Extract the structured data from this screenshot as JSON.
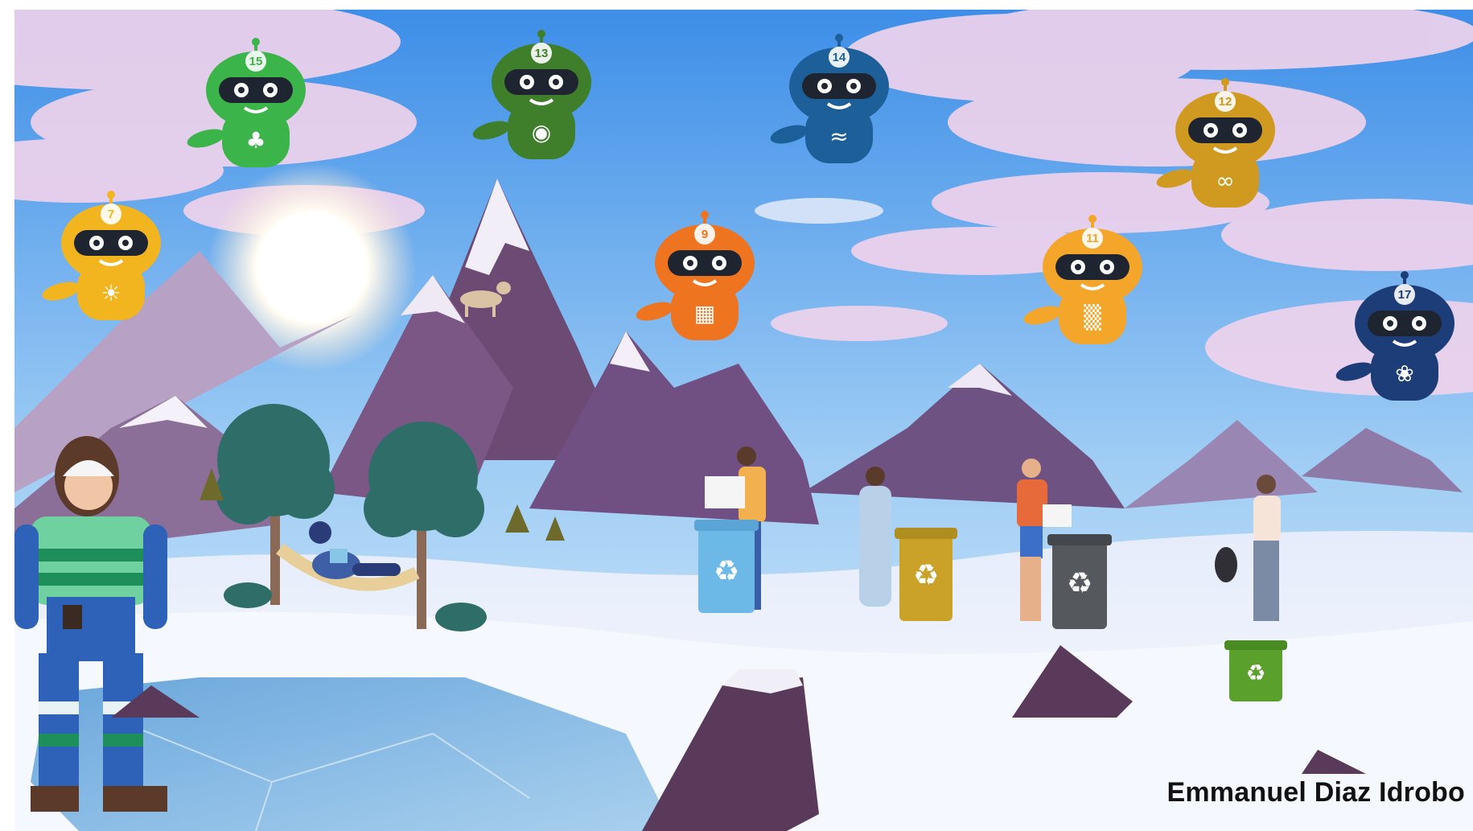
{
  "credit": {
    "author": "Emmanuel Diaz Idrobo"
  },
  "colors": {
    "sky_top": "#3d8ee8",
    "sky_bottom": "#cfe6fb",
    "cloud": "#efd2ec",
    "mountain_dark": "#5a3a63",
    "mountain_mid": "#8a6c9a",
    "snow": "#f4f7fd",
    "ice": "#7fb2e0",
    "robot_green": "#3bb44a",
    "robot_darkgreen": "#3f7f2b",
    "robot_blue": "#1d5f98",
    "robot_navy": "#1d3d78",
    "robot_yellow": "#f2b51f",
    "robot_orange": "#ee7420",
    "robot_gold": "#f3a62a"
  },
  "robots": [
    {
      "number": "15",
      "icon": "tree-life-icon",
      "color": "#3bb44a"
    },
    {
      "number": "13",
      "icon": "eye-globe-icon",
      "color": "#3f7f2b"
    },
    {
      "number": "14",
      "icon": "fish-icon",
      "color": "#1d5f98"
    },
    {
      "number": "12",
      "icon": "infinity-icon",
      "color": "#cf9a1f"
    },
    {
      "number": "7",
      "icon": "sun-icon",
      "color": "#f2b51f"
    },
    {
      "number": "9",
      "icon": "cubes-icon",
      "color": "#ee7420"
    },
    {
      "number": "11",
      "icon": "city-icon",
      "color": "#f3a62a"
    },
    {
      "number": "17",
      "icon": "flower-icon",
      "color": "#1d3d78"
    }
  ],
  "bins": [
    {
      "icon": "recycle-icon",
      "color": "#6cb8e6"
    },
    {
      "icon": "recycle-icon",
      "color": "#c9a227"
    },
    {
      "icon": "recycle-icon",
      "color": "#55585c"
    },
    {
      "icon": "recycle-icon",
      "color": "#5aa02c"
    }
  ]
}
